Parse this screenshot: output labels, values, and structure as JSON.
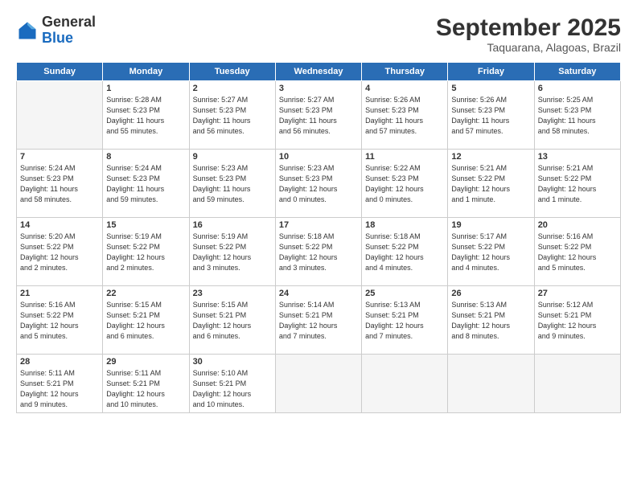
{
  "logo": {
    "general": "General",
    "blue": "Blue"
  },
  "header": {
    "month": "September 2025",
    "location": "Taquarana, Alagoas, Brazil"
  },
  "weekdays": [
    "Sunday",
    "Monday",
    "Tuesday",
    "Wednesday",
    "Thursday",
    "Friday",
    "Saturday"
  ],
  "weeks": [
    [
      {
        "day": "",
        "info": ""
      },
      {
        "day": "1",
        "info": "Sunrise: 5:28 AM\nSunset: 5:23 PM\nDaylight: 11 hours\nand 55 minutes."
      },
      {
        "day": "2",
        "info": "Sunrise: 5:27 AM\nSunset: 5:23 PM\nDaylight: 11 hours\nand 56 minutes."
      },
      {
        "day": "3",
        "info": "Sunrise: 5:27 AM\nSunset: 5:23 PM\nDaylight: 11 hours\nand 56 minutes."
      },
      {
        "day": "4",
        "info": "Sunrise: 5:26 AM\nSunset: 5:23 PM\nDaylight: 11 hours\nand 57 minutes."
      },
      {
        "day": "5",
        "info": "Sunrise: 5:26 AM\nSunset: 5:23 PM\nDaylight: 11 hours\nand 57 minutes."
      },
      {
        "day": "6",
        "info": "Sunrise: 5:25 AM\nSunset: 5:23 PM\nDaylight: 11 hours\nand 58 minutes."
      }
    ],
    [
      {
        "day": "7",
        "info": "Sunrise: 5:24 AM\nSunset: 5:23 PM\nDaylight: 11 hours\nand 58 minutes."
      },
      {
        "day": "8",
        "info": "Sunrise: 5:24 AM\nSunset: 5:23 PM\nDaylight: 11 hours\nand 59 minutes."
      },
      {
        "day": "9",
        "info": "Sunrise: 5:23 AM\nSunset: 5:23 PM\nDaylight: 11 hours\nand 59 minutes."
      },
      {
        "day": "10",
        "info": "Sunrise: 5:23 AM\nSunset: 5:23 PM\nDaylight: 12 hours\nand 0 minutes."
      },
      {
        "day": "11",
        "info": "Sunrise: 5:22 AM\nSunset: 5:23 PM\nDaylight: 12 hours\nand 0 minutes."
      },
      {
        "day": "12",
        "info": "Sunrise: 5:21 AM\nSunset: 5:22 PM\nDaylight: 12 hours\nand 1 minute."
      },
      {
        "day": "13",
        "info": "Sunrise: 5:21 AM\nSunset: 5:22 PM\nDaylight: 12 hours\nand 1 minute."
      }
    ],
    [
      {
        "day": "14",
        "info": "Sunrise: 5:20 AM\nSunset: 5:22 PM\nDaylight: 12 hours\nand 2 minutes."
      },
      {
        "day": "15",
        "info": "Sunrise: 5:19 AM\nSunset: 5:22 PM\nDaylight: 12 hours\nand 2 minutes."
      },
      {
        "day": "16",
        "info": "Sunrise: 5:19 AM\nSunset: 5:22 PM\nDaylight: 12 hours\nand 3 minutes."
      },
      {
        "day": "17",
        "info": "Sunrise: 5:18 AM\nSunset: 5:22 PM\nDaylight: 12 hours\nand 3 minutes."
      },
      {
        "day": "18",
        "info": "Sunrise: 5:18 AM\nSunset: 5:22 PM\nDaylight: 12 hours\nand 4 minutes."
      },
      {
        "day": "19",
        "info": "Sunrise: 5:17 AM\nSunset: 5:22 PM\nDaylight: 12 hours\nand 4 minutes."
      },
      {
        "day": "20",
        "info": "Sunrise: 5:16 AM\nSunset: 5:22 PM\nDaylight: 12 hours\nand 5 minutes."
      }
    ],
    [
      {
        "day": "21",
        "info": "Sunrise: 5:16 AM\nSunset: 5:22 PM\nDaylight: 12 hours\nand 5 minutes."
      },
      {
        "day": "22",
        "info": "Sunrise: 5:15 AM\nSunset: 5:21 PM\nDaylight: 12 hours\nand 6 minutes."
      },
      {
        "day": "23",
        "info": "Sunrise: 5:15 AM\nSunset: 5:21 PM\nDaylight: 12 hours\nand 6 minutes."
      },
      {
        "day": "24",
        "info": "Sunrise: 5:14 AM\nSunset: 5:21 PM\nDaylight: 12 hours\nand 7 minutes."
      },
      {
        "day": "25",
        "info": "Sunrise: 5:13 AM\nSunset: 5:21 PM\nDaylight: 12 hours\nand 7 minutes."
      },
      {
        "day": "26",
        "info": "Sunrise: 5:13 AM\nSunset: 5:21 PM\nDaylight: 12 hours\nand 8 minutes."
      },
      {
        "day": "27",
        "info": "Sunrise: 5:12 AM\nSunset: 5:21 PM\nDaylight: 12 hours\nand 9 minutes."
      }
    ],
    [
      {
        "day": "28",
        "info": "Sunrise: 5:11 AM\nSunset: 5:21 PM\nDaylight: 12 hours\nand 9 minutes."
      },
      {
        "day": "29",
        "info": "Sunrise: 5:11 AM\nSunset: 5:21 PM\nDaylight: 12 hours\nand 10 minutes."
      },
      {
        "day": "30",
        "info": "Sunrise: 5:10 AM\nSunset: 5:21 PM\nDaylight: 12 hours\nand 10 minutes."
      },
      {
        "day": "",
        "info": ""
      },
      {
        "day": "",
        "info": ""
      },
      {
        "day": "",
        "info": ""
      },
      {
        "day": "",
        "info": ""
      }
    ]
  ]
}
